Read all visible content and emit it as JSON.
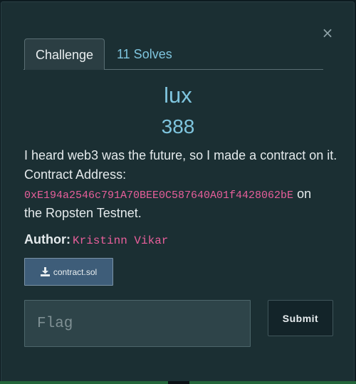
{
  "modal": {
    "close_label": "×",
    "tabs": [
      {
        "label": "Challenge"
      },
      {
        "label": "11 Solves"
      }
    ],
    "title": "lux",
    "points": "388",
    "description": {
      "line1": "I heard web3 was the future, so I made a contract on it.",
      "line2": "Contract Address:",
      "address": "0xE194a2546c791A70BEE0C587640A01f4428062bE",
      "suffix": " on",
      "line4": "the Ropsten Testnet."
    },
    "author": {
      "label": "Author:",
      "name": "Kristinn Vikar"
    },
    "download": {
      "icon": "download-icon",
      "label": "contract.sol"
    },
    "flag_input": {
      "placeholder": "Flag",
      "value": ""
    },
    "submit_label": "Submit"
  },
  "colors": {
    "modal_bg": "#1b2f33",
    "accent_blue": "#7fc5de",
    "code_pink": "#e85f9b",
    "button_blue": "#3e5d79"
  }
}
